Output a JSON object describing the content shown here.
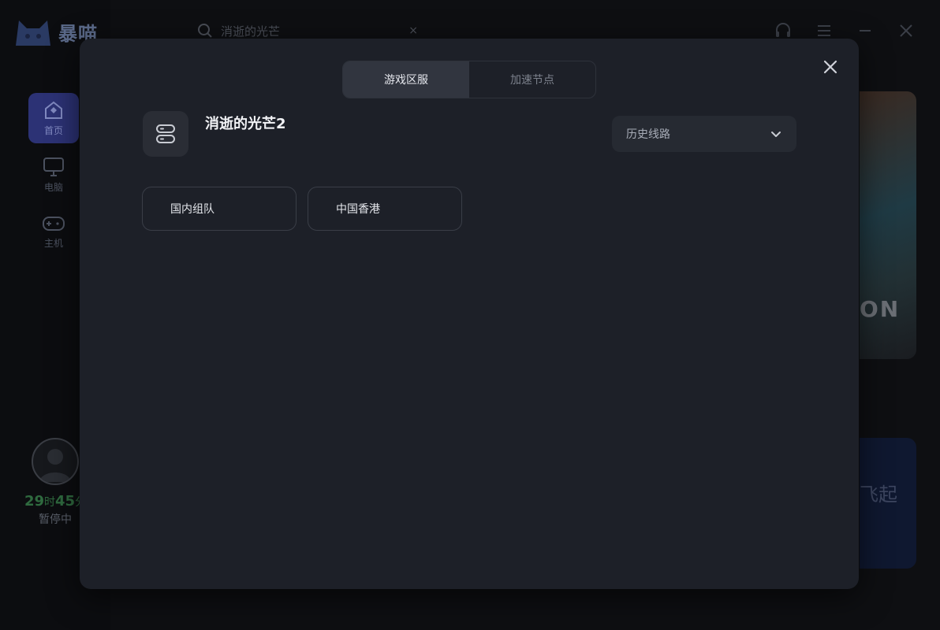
{
  "app": {
    "logo_text": "暴喵",
    "search_value": "消逝的光芒",
    "clear_label": "×",
    "nav": [
      {
        "label": "首页"
      },
      {
        "label": "电脑"
      },
      {
        "label": "主机"
      }
    ],
    "user": {
      "timer_hours": "29",
      "timer_hours_unit": "时",
      "timer_minutes": "45",
      "timer_minutes_unit": "分",
      "status": "暂停中"
    },
    "banner_text": "ON",
    "card_text": "飞起"
  },
  "modal": {
    "tabs": [
      {
        "label": "游戏区服",
        "active": true
      },
      {
        "label": "加速节点",
        "active": false
      }
    ],
    "game_title": "消逝的光芒2",
    "history_select": {
      "label": "历史线路"
    },
    "regions": [
      {
        "label": "国内组队"
      },
      {
        "label": "中国香港"
      }
    ]
  },
  "colors": {
    "accent": "#2c3275",
    "modal_bg": "#1d2028",
    "tab_active": "#31353f"
  }
}
